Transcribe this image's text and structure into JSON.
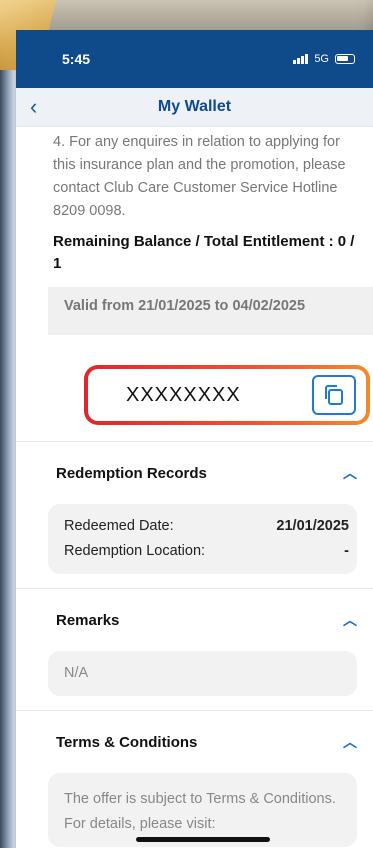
{
  "status_bar": {
    "time": "5:45",
    "network": "5G"
  },
  "header": {
    "title": "My Wallet",
    "back_icon": "chevron-left-icon"
  },
  "terms_paragraph": "4. For any enquires in relation to applying for this insurance plan and the promotion, please contact Club Care Customer Service Hotline 8209 0098.",
  "balance": {
    "label": "Remaining Balance / Total Entitlement : 0 / 1"
  },
  "validity": "Valid from 21/01/2025 to 04/02/2025",
  "voucher": {
    "code": "XXXXXXXX",
    "copy_icon": "copy-icon",
    "border_colors": [
      "#e0262b",
      "#f58a2a"
    ]
  },
  "redemption": {
    "title": "Redemption Records",
    "date_label": "Redeemed Date:",
    "date_value": "21/01/2025",
    "location_label": "Redemption Location:",
    "location_value": "-"
  },
  "remarks": {
    "title": "Remarks",
    "value": "N/A"
  },
  "tnc": {
    "title": "Terms & Conditions",
    "text": "The offer is subject to Terms & Conditions. For details, please visit:"
  },
  "colors": {
    "primary": "#0f4a8a",
    "accent": "#1a6ad0"
  }
}
